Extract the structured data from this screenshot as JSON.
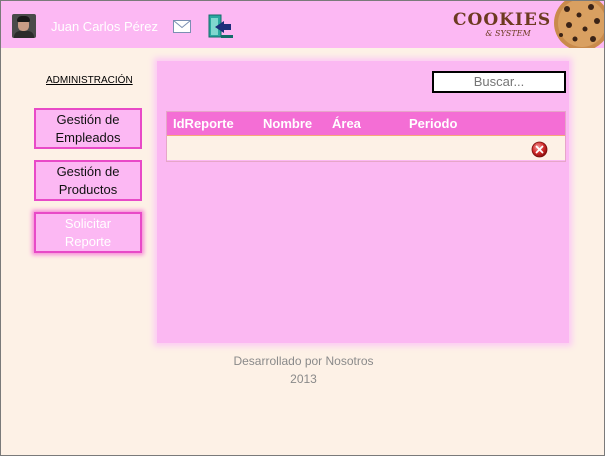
{
  "header": {
    "username": "Juan Carlos Pérez",
    "logo_main": "COOKIES",
    "logo_sub": "& SYSTEM",
    "icons": [
      "avatar",
      "mail-icon",
      "logout-icon",
      "cookie-icon"
    ]
  },
  "sidebar": {
    "title": "ADMINISTRACIÓN",
    "items": [
      {
        "line1": "Gestión de",
        "line2": "Empleados"
      },
      {
        "line1": "Gestión de",
        "line2": "Productos"
      },
      {
        "line1": "Solicitar",
        "line2": "Reporte"
      }
    ]
  },
  "main": {
    "search_placeholder": "Buscar...",
    "table": {
      "columns": [
        "IdReporte",
        "Nombre",
        "Área",
        "Periodo"
      ],
      "rows": [
        {
          "cells": [
            "",
            "",
            "",
            ""
          ],
          "action": "delete-icon"
        }
      ]
    }
  },
  "footer": {
    "line1": "Desarrollado por Nosotros",
    "line2": "2013"
  },
  "colors": {
    "header_bg": "#fcb8f3",
    "panel_bg": "#fbb8f2",
    "table_header_bg": "#f46ed5",
    "button_border": "#e84ac7",
    "page_bg": "#fdf1e6"
  }
}
